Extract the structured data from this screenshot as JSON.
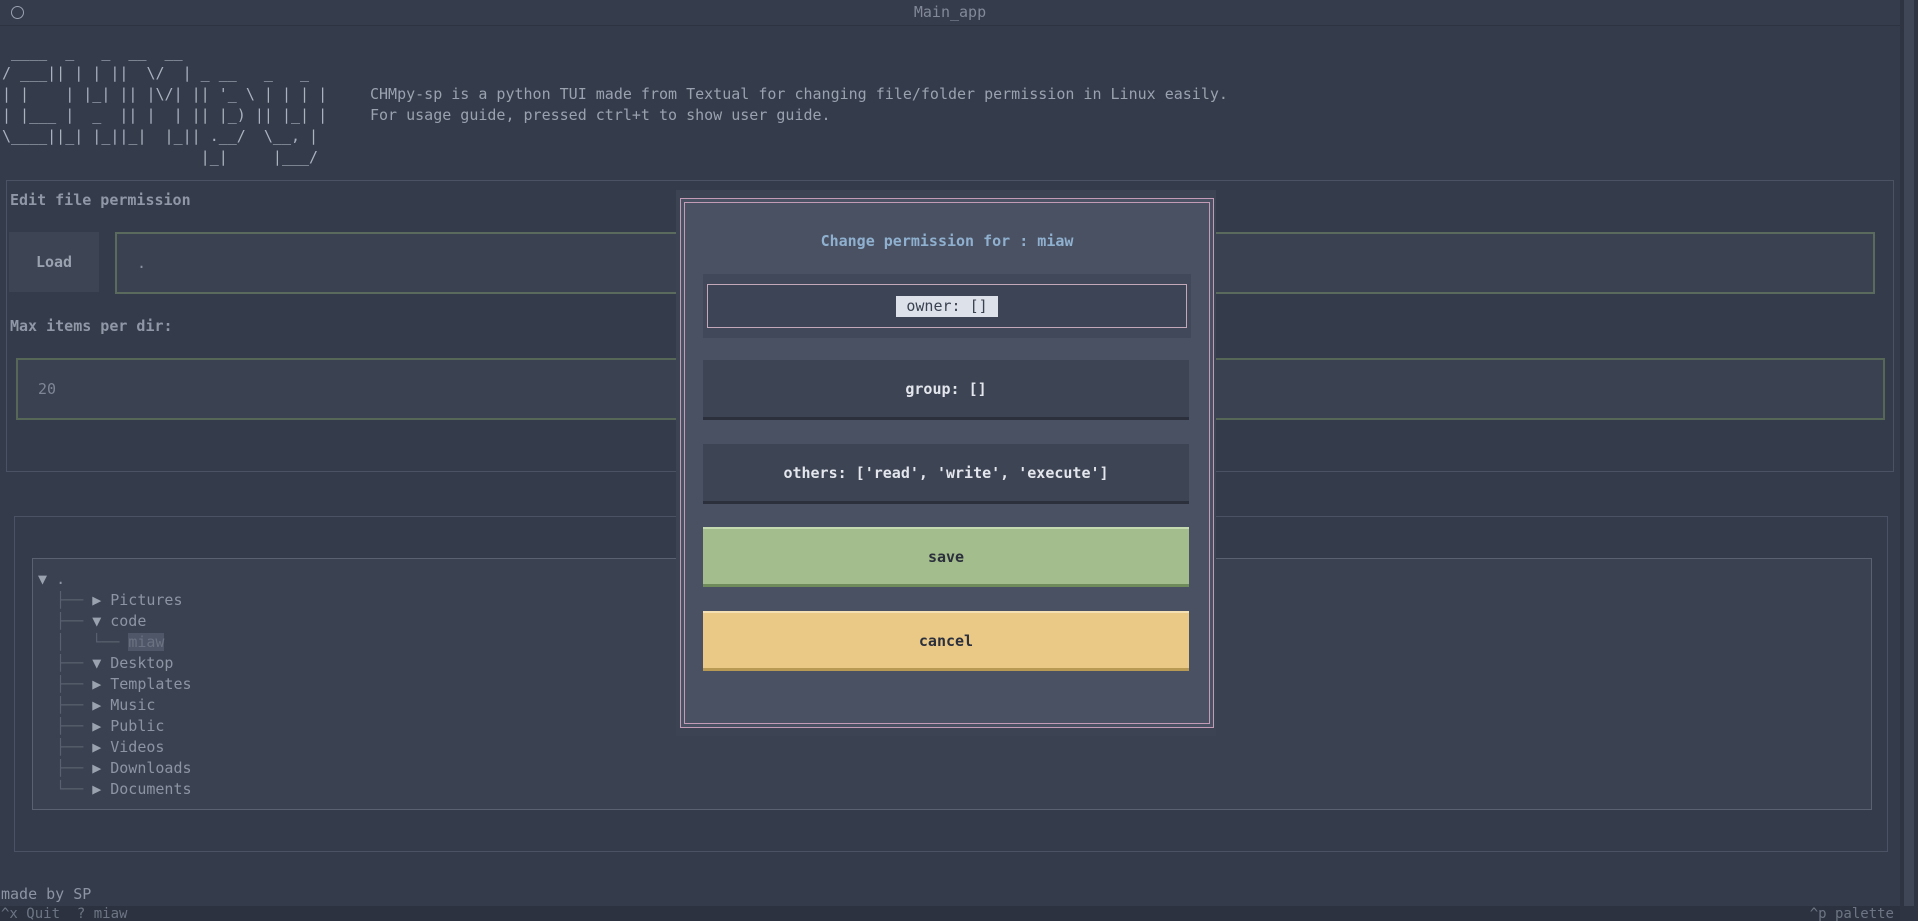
{
  "window": {
    "title": "Main_app"
  },
  "header": {
    "ascii_logo": " ____  _   _  __  __                \n/ ___|| | | ||  \\/  | _ __   _   _ \n| |    | |_| || |\\/| || '_ \\ | | | |\n| |___ |  _  || |  | || |_) || |_| |\n\\____||_| |_||_|  |_|| .__/  \\__, |\n                      |_|     |___/ ",
    "description_line1": "CHMpy-sp is a python TUI made from Textual for changing file/folder permission in Linux easily.",
    "description_line2": "For usage guide, pressed ctrl+t to show user guide."
  },
  "edit": {
    "label": "Edit file permission",
    "load_label": "Load",
    "path_value": ".",
    "max_label": "Max items per dir:",
    "max_value": "20"
  },
  "tree": {
    "items": [
      {
        "prefix": "",
        "tri": "▼",
        "label": "."
      },
      {
        "prefix": "  ├── ",
        "tri": "▶",
        "label": "Pictures"
      },
      {
        "prefix": "  ├── ",
        "tri": "▼",
        "label": "code"
      },
      {
        "prefix": "  │   └── ",
        "tri": "",
        "label": "miaw"
      },
      {
        "prefix": "  ├── ",
        "tri": "▼",
        "label": "Desktop"
      },
      {
        "prefix": "  ├── ",
        "tri": "▶",
        "label": "Templates"
      },
      {
        "prefix": "  ├── ",
        "tri": "▶",
        "label": "Music"
      },
      {
        "prefix": "  ├── ",
        "tri": "▶",
        "label": "Public"
      },
      {
        "prefix": "  ├── ",
        "tri": "▶",
        "label": "Videos"
      },
      {
        "prefix": "  ├── ",
        "tri": "▶",
        "label": "Downloads"
      },
      {
        "prefix": "  └── ",
        "tri": "▶",
        "label": "Documents"
      }
    ]
  },
  "modal": {
    "title": "Change permission for : miaw",
    "owner_label": "owner: []",
    "group_label": "group: []",
    "others_label": "others: ['read', 'write', 'execute']",
    "save_label": "save",
    "cancel_label": "cancel"
  },
  "footer": {
    "made_by": "made by SP",
    "quit_key": "^x",
    "quit_label": "Quit",
    "help_key": "?",
    "help_label": "miaw",
    "palette_key": "^p",
    "palette_label": "palette"
  },
  "colors": {
    "background": "#343b4a",
    "save": "#a3bd8c",
    "cancel": "#eac987",
    "modal_border": "#c49bb7",
    "title_accent": "#8fb0cf"
  }
}
